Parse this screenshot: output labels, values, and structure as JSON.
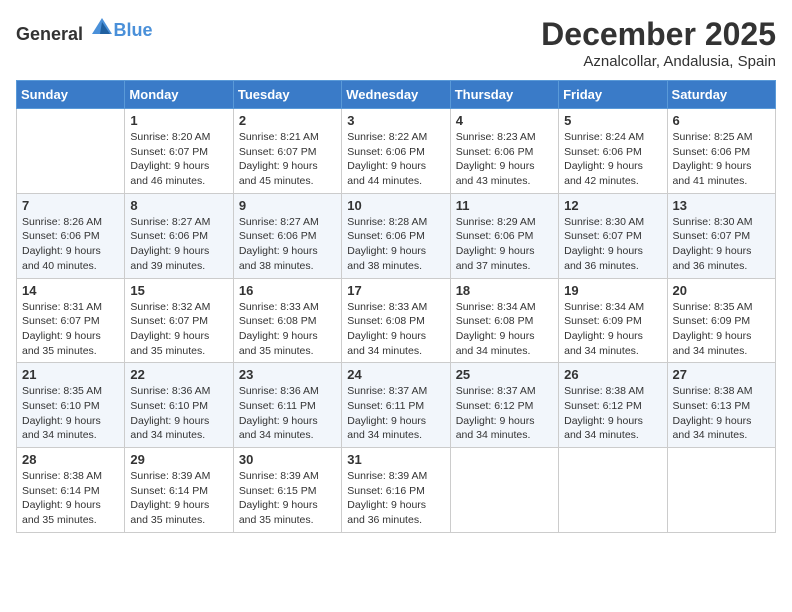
{
  "logo": {
    "general": "General",
    "blue": "Blue"
  },
  "header": {
    "month": "December 2025",
    "location": "Aznalcollar, Andalusia, Spain"
  },
  "weekdays": [
    "Sunday",
    "Monday",
    "Tuesday",
    "Wednesday",
    "Thursday",
    "Friday",
    "Saturday"
  ],
  "weeks": [
    [
      {
        "day": "",
        "sunrise": "",
        "sunset": "",
        "daylight": ""
      },
      {
        "day": "1",
        "sunrise": "Sunrise: 8:20 AM",
        "sunset": "Sunset: 6:07 PM",
        "daylight": "Daylight: 9 hours and 46 minutes."
      },
      {
        "day": "2",
        "sunrise": "Sunrise: 8:21 AM",
        "sunset": "Sunset: 6:07 PM",
        "daylight": "Daylight: 9 hours and 45 minutes."
      },
      {
        "day": "3",
        "sunrise": "Sunrise: 8:22 AM",
        "sunset": "Sunset: 6:06 PM",
        "daylight": "Daylight: 9 hours and 44 minutes."
      },
      {
        "day": "4",
        "sunrise": "Sunrise: 8:23 AM",
        "sunset": "Sunset: 6:06 PM",
        "daylight": "Daylight: 9 hours and 43 minutes."
      },
      {
        "day": "5",
        "sunrise": "Sunrise: 8:24 AM",
        "sunset": "Sunset: 6:06 PM",
        "daylight": "Daylight: 9 hours and 42 minutes."
      },
      {
        "day": "6",
        "sunrise": "Sunrise: 8:25 AM",
        "sunset": "Sunset: 6:06 PM",
        "daylight": "Daylight: 9 hours and 41 minutes."
      }
    ],
    [
      {
        "day": "7",
        "sunrise": "Sunrise: 8:26 AM",
        "sunset": "Sunset: 6:06 PM",
        "daylight": "Daylight: 9 hours and 40 minutes."
      },
      {
        "day": "8",
        "sunrise": "Sunrise: 8:27 AM",
        "sunset": "Sunset: 6:06 PM",
        "daylight": "Daylight: 9 hours and 39 minutes."
      },
      {
        "day": "9",
        "sunrise": "Sunrise: 8:27 AM",
        "sunset": "Sunset: 6:06 PM",
        "daylight": "Daylight: 9 hours and 38 minutes."
      },
      {
        "day": "10",
        "sunrise": "Sunrise: 8:28 AM",
        "sunset": "Sunset: 6:06 PM",
        "daylight": "Daylight: 9 hours and 38 minutes."
      },
      {
        "day": "11",
        "sunrise": "Sunrise: 8:29 AM",
        "sunset": "Sunset: 6:06 PM",
        "daylight": "Daylight: 9 hours and 37 minutes."
      },
      {
        "day": "12",
        "sunrise": "Sunrise: 8:30 AM",
        "sunset": "Sunset: 6:07 PM",
        "daylight": "Daylight: 9 hours and 36 minutes."
      },
      {
        "day": "13",
        "sunrise": "Sunrise: 8:30 AM",
        "sunset": "Sunset: 6:07 PM",
        "daylight": "Daylight: 9 hours and 36 minutes."
      }
    ],
    [
      {
        "day": "14",
        "sunrise": "Sunrise: 8:31 AM",
        "sunset": "Sunset: 6:07 PM",
        "daylight": "Daylight: 9 hours and 35 minutes."
      },
      {
        "day": "15",
        "sunrise": "Sunrise: 8:32 AM",
        "sunset": "Sunset: 6:07 PM",
        "daylight": "Daylight: 9 hours and 35 minutes."
      },
      {
        "day": "16",
        "sunrise": "Sunrise: 8:33 AM",
        "sunset": "Sunset: 6:08 PM",
        "daylight": "Daylight: 9 hours and 35 minutes."
      },
      {
        "day": "17",
        "sunrise": "Sunrise: 8:33 AM",
        "sunset": "Sunset: 6:08 PM",
        "daylight": "Daylight: 9 hours and 34 minutes."
      },
      {
        "day": "18",
        "sunrise": "Sunrise: 8:34 AM",
        "sunset": "Sunset: 6:08 PM",
        "daylight": "Daylight: 9 hours and 34 minutes."
      },
      {
        "day": "19",
        "sunrise": "Sunrise: 8:34 AM",
        "sunset": "Sunset: 6:09 PM",
        "daylight": "Daylight: 9 hours and 34 minutes."
      },
      {
        "day": "20",
        "sunrise": "Sunrise: 8:35 AM",
        "sunset": "Sunset: 6:09 PM",
        "daylight": "Daylight: 9 hours and 34 minutes."
      }
    ],
    [
      {
        "day": "21",
        "sunrise": "Sunrise: 8:35 AM",
        "sunset": "Sunset: 6:10 PM",
        "daylight": "Daylight: 9 hours and 34 minutes."
      },
      {
        "day": "22",
        "sunrise": "Sunrise: 8:36 AM",
        "sunset": "Sunset: 6:10 PM",
        "daylight": "Daylight: 9 hours and 34 minutes."
      },
      {
        "day": "23",
        "sunrise": "Sunrise: 8:36 AM",
        "sunset": "Sunset: 6:11 PM",
        "daylight": "Daylight: 9 hours and 34 minutes."
      },
      {
        "day": "24",
        "sunrise": "Sunrise: 8:37 AM",
        "sunset": "Sunset: 6:11 PM",
        "daylight": "Daylight: 9 hours and 34 minutes."
      },
      {
        "day": "25",
        "sunrise": "Sunrise: 8:37 AM",
        "sunset": "Sunset: 6:12 PM",
        "daylight": "Daylight: 9 hours and 34 minutes."
      },
      {
        "day": "26",
        "sunrise": "Sunrise: 8:38 AM",
        "sunset": "Sunset: 6:12 PM",
        "daylight": "Daylight: 9 hours and 34 minutes."
      },
      {
        "day": "27",
        "sunrise": "Sunrise: 8:38 AM",
        "sunset": "Sunset: 6:13 PM",
        "daylight": "Daylight: 9 hours and 34 minutes."
      }
    ],
    [
      {
        "day": "28",
        "sunrise": "Sunrise: 8:38 AM",
        "sunset": "Sunset: 6:14 PM",
        "daylight": "Daylight: 9 hours and 35 minutes."
      },
      {
        "day": "29",
        "sunrise": "Sunrise: 8:39 AM",
        "sunset": "Sunset: 6:14 PM",
        "daylight": "Daylight: 9 hours and 35 minutes."
      },
      {
        "day": "30",
        "sunrise": "Sunrise: 8:39 AM",
        "sunset": "Sunset: 6:15 PM",
        "daylight": "Daylight: 9 hours and 35 minutes."
      },
      {
        "day": "31",
        "sunrise": "Sunrise: 8:39 AM",
        "sunset": "Sunset: 6:16 PM",
        "daylight": "Daylight: 9 hours and 36 minutes."
      },
      {
        "day": "",
        "sunrise": "",
        "sunset": "",
        "daylight": ""
      },
      {
        "day": "",
        "sunrise": "",
        "sunset": "",
        "daylight": ""
      },
      {
        "day": "",
        "sunrise": "",
        "sunset": "",
        "daylight": ""
      }
    ]
  ]
}
